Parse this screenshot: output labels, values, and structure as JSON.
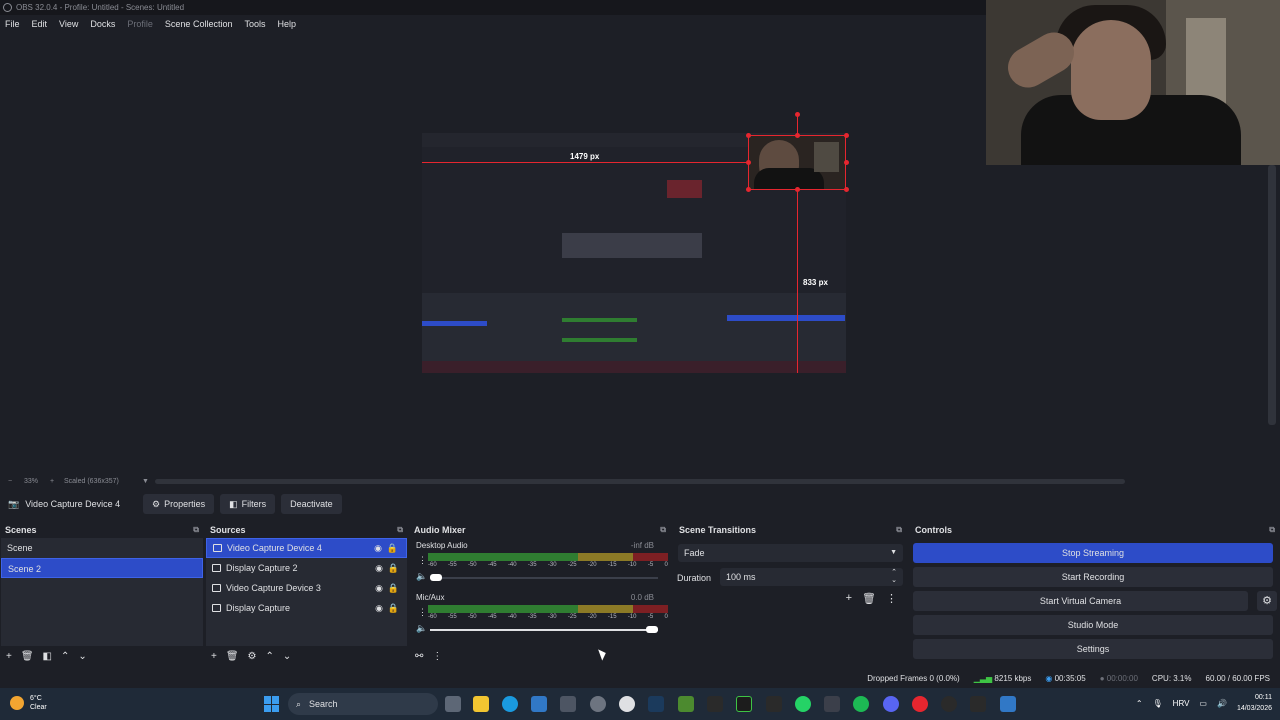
{
  "window": {
    "title": "OBS 32.0.4 - Profile: Untitled - Scenes: Untitled"
  },
  "menu": [
    "File",
    "Edit",
    "View",
    "Docks",
    "Profile",
    "Scene Collection",
    "Tools",
    "Help"
  ],
  "menu_disabled": "Profile",
  "preview": {
    "guide_h_label": "1479 px",
    "guide_v_label": "833 px"
  },
  "zoom": {
    "minus": "−",
    "level": "33%",
    "plus": "+",
    "scale_label": "Scaled (636x357)"
  },
  "context": {
    "source_name": "Video Capture Device 4",
    "properties": "Properties",
    "filters": "Filters",
    "deactivate": "Deactivate"
  },
  "scenes": {
    "title": "Scenes",
    "items": [
      "Scene",
      "Scene 2"
    ],
    "selected_index": 1
  },
  "sources": {
    "title": "Sources",
    "items": [
      "Video Capture Device 4",
      "Display Capture 2",
      "Video Capture Device 3",
      "Display Capture"
    ],
    "selected_index": 0
  },
  "mixer": {
    "title": "Audio Mixer",
    "channels": [
      {
        "name": "Desktop Audio",
        "db": "-inf dB",
        "volume": 0.0
      },
      {
        "name": "Mic/Aux",
        "db": "0.0 dB",
        "volume": 1.0
      }
    ],
    "ticks": [
      "-60",
      "-55",
      "-50",
      "-45",
      "-40",
      "-35",
      "-30",
      "-25",
      "-20",
      "-15",
      "-10",
      "-5",
      "0"
    ]
  },
  "transitions": {
    "title": "Scene Transitions",
    "selected": "Fade",
    "duration_label": "Duration",
    "duration_value": "100 ms"
  },
  "controls": {
    "title": "Controls",
    "stop_streaming": "Stop Streaming",
    "start_recording": "Start Recording",
    "start_virtual_camera": "Start Virtual Camera",
    "studio_mode": "Studio Mode",
    "settings": "Settings"
  },
  "status": {
    "dropped_frames": "Dropped Frames 0 (0.0%)",
    "bitrate": "8215 kbps",
    "stream_time": "00:35:05",
    "record_time": "00:00:00",
    "cpu": "CPU: 3.1%",
    "fps": "60.00 / 60.00 FPS"
  },
  "taskbar": {
    "temperature": "6°C",
    "weather": "Clear",
    "search_placeholder": "Search",
    "language": "HRV",
    "time": "00:11",
    "date": "14/03/2026"
  },
  "colors": {
    "accent": "#2d4cc8",
    "guide_red": "#e6262f",
    "meter_green": "#2f7d31",
    "meter_yellow": "#8c7a26",
    "meter_red": "#7d1f23"
  }
}
